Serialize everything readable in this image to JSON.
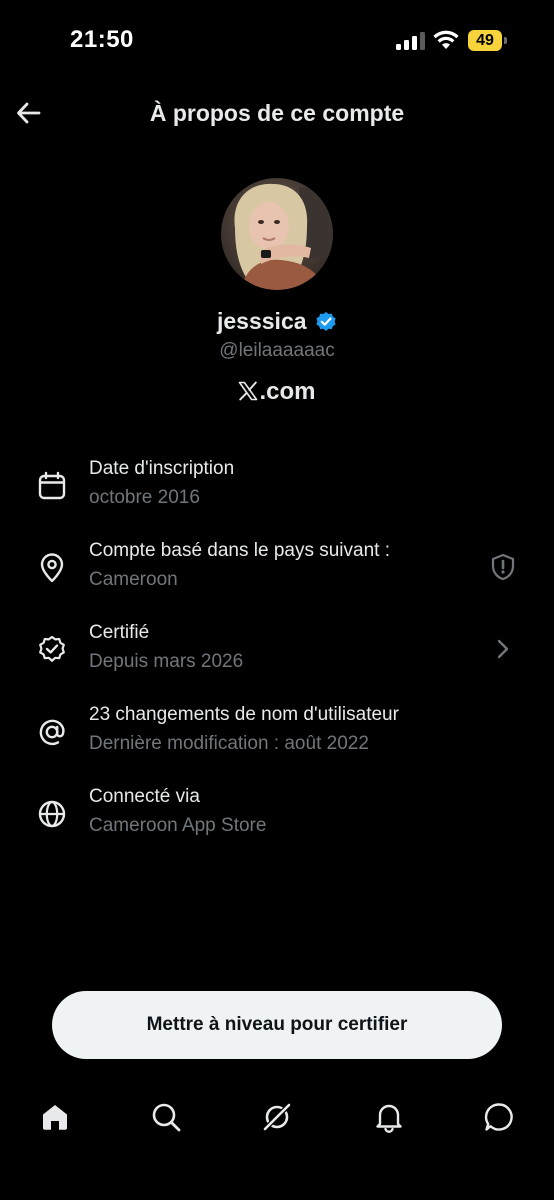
{
  "status_bar": {
    "time": "21:50",
    "battery": "49"
  },
  "header": {
    "title": "À propos de ce compte",
    "back_icon": "arrow-left-icon"
  },
  "profile": {
    "display_name": "jesssica",
    "verified": true,
    "handle": "@leilaaaaaac",
    "site_text": ".com",
    "site_logo": "x-logo"
  },
  "info_rows": [
    {
      "icon": "calendar-icon",
      "title": "Date d'inscription",
      "subtitle": "octobre 2016"
    },
    {
      "icon": "location-pin-icon",
      "title": "Compte basé dans le pays suivant :",
      "subtitle": "Cameroon",
      "trailing": "shield-info-icon"
    },
    {
      "icon": "verified-badge-outline-icon",
      "title": "Certifié",
      "subtitle": "Depuis mars 2026",
      "trailing": "chevron-right-icon"
    },
    {
      "icon": "at-sign-icon",
      "title": "23 changements de nom d'utilisateur",
      "subtitle": "Dernière modification : août 2022"
    },
    {
      "icon": "globe-icon",
      "title": "Connecté via",
      "subtitle": "Cameroon App Store"
    }
  ],
  "upgrade_button": {
    "label": "Mettre à niveau pour certifier"
  },
  "bottom_nav": [
    {
      "icon": "home-icon",
      "active": true
    },
    {
      "icon": "search-icon"
    },
    {
      "icon": "grok-icon"
    },
    {
      "icon": "bell-icon"
    },
    {
      "icon": "messages-icon"
    }
  ],
  "colors": {
    "background": "#000000",
    "text_primary": "#e7e9ea",
    "text_secondary": "#71767b",
    "verified_blue": "#1d9bf0",
    "battery_yellow": "#f7d33c",
    "button_bg": "#eff3f4"
  }
}
